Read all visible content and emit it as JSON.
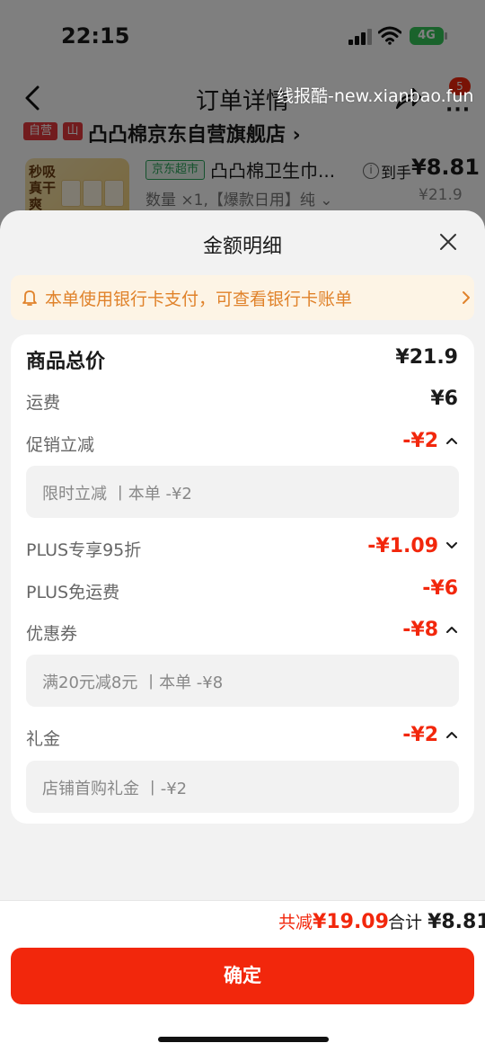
{
  "status_bar": {
    "time": "22:15",
    "network": "4G"
  },
  "nav": {
    "title": "订单详情",
    "badge": "5"
  },
  "watermark": "线报酷-new.xianbao.fun",
  "shop": {
    "tag1": "自营",
    "tag2": "山",
    "name": "凸凸棉京东自营旗舰店 ›"
  },
  "product": {
    "thumb_text": "秒吸真干爽",
    "channel_tag": "京东超市",
    "name": "凸凸棉卫生巾...",
    "price_label": "到手",
    "price": "¥8.81",
    "original_price": "¥21.9",
    "spec": "数量 ×1,【爆款日用】纯 ⌄"
  },
  "sheet": {
    "title": "金额明细",
    "notice": "本单使用银行卡支付，可查看银行卡账单",
    "rows": {
      "goods_total": {
        "label": "商品总价",
        "value": "¥21.9"
      },
      "shipping": {
        "label": "运费",
        "value": "¥6"
      },
      "promo": {
        "label": "促销立减",
        "value": "-¥2",
        "detail": "限时立减 丨本单 -¥2"
      },
      "plus_discount": {
        "label": "PLUS专享95折",
        "value": "-¥1.09"
      },
      "plus_shipping": {
        "label": "PLUS免运费",
        "value": "-¥6"
      },
      "coupon": {
        "label": "优惠券",
        "value": "-¥8",
        "detail": "满20元减8元 丨本单 -¥8"
      },
      "gift": {
        "label": "礼金",
        "value": "-¥2",
        "detail": "店铺首购礼金 丨-¥2"
      }
    }
  },
  "footer": {
    "reduce_label": "共减",
    "reduce_value": "¥19.09",
    "sum_label": "合计",
    "sum_value": "¥8.81",
    "confirm": "确定"
  },
  "colors": {
    "accent": "#f2270c",
    "notice_text": "#e0822a",
    "notice_bg": "#fdf4e5",
    "jd_green": "#2aa45a"
  }
}
